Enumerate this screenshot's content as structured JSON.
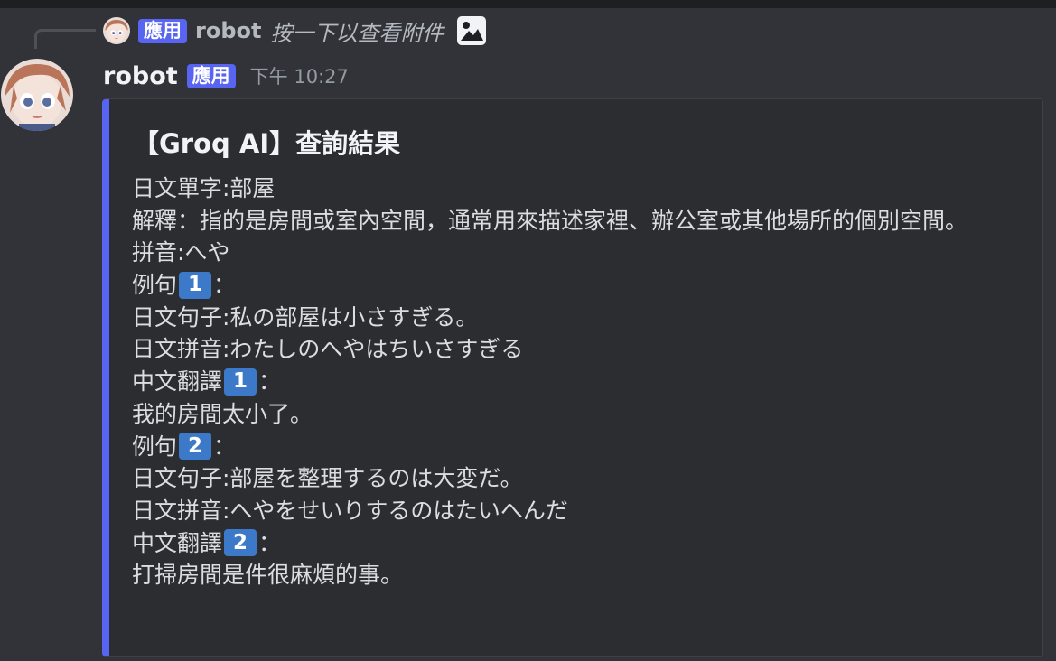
{
  "reply": {
    "badge": "應用",
    "name": "robot",
    "text": "按一下以查看附件",
    "icon": "image-icon"
  },
  "message": {
    "author": "robot",
    "badge": "應用",
    "timestamp": "下午 10:27"
  },
  "embed": {
    "accent_color": "#5865f2",
    "title": "【Groq AI】查詢結果",
    "lines": {
      "word": "日文單字:部屋",
      "explain": "解釋：指的是房間或室內空間，通常用來描述家裡、辦公室或其他場所的個別空間。",
      "pinyin": "拼音:へや",
      "ex1_label": "例句",
      "ex1_num": "1",
      "ex1_colon": "：",
      "ex1_jp": "日文句子:私の部屋は小さすぎる。",
      "ex1_kana": "日文拼音:わたしのへやはちいさすぎる",
      "ex1_zh_label": "中文翻譯",
      "ex1_zh_num": "1",
      "ex1_zh_colon": "：",
      "ex1_zh": "我的房間太小了。",
      "ex2_label": "例句",
      "ex2_num": "2",
      "ex2_colon": "：",
      "ex2_jp": "日文句子:部屋を整理するのは大変だ。",
      "ex2_kana": "日文拼音:へやをせいりするのはたいへんだ",
      "ex2_zh_label": "中文翻譯",
      "ex2_zh_num": "2",
      "ex2_zh_colon": "：",
      "ex2_zh": "打掃房間是件很麻煩的事。"
    }
  }
}
